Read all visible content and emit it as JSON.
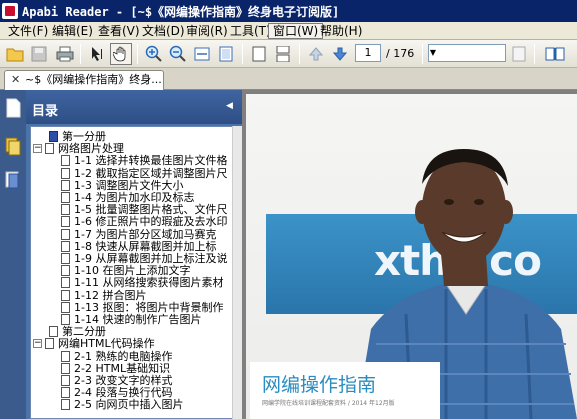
{
  "window": {
    "title": "Apabi Reader - [~$《网编操作指南》终身电子订阅版]"
  },
  "menu": {
    "items": [
      "文件(F)",
      "编辑(E)",
      "查看(V)",
      "文档(D)",
      "审阅(R)",
      "工具(T)",
      "窗口(W)",
      "帮助(H)"
    ],
    "active": "窗口(W)"
  },
  "toolbar": {
    "current_page": "1",
    "page_total": "/ 176",
    "icons": [
      "open-folder",
      "save",
      "print",
      "select-arrow",
      "hand",
      "zoom-in",
      "zoom-out",
      "fit-width",
      "fit-page",
      "single-page",
      "continuous",
      "previous-page",
      "next-page",
      "zoom-dropdown",
      "bookmark"
    ]
  },
  "tab": {
    "label": "~$《网编操作指南》终身..."
  },
  "panel": {
    "title": "目录"
  },
  "outline": [
    {
      "label": "第一分册",
      "level": 0,
      "kind": "book"
    },
    {
      "label": "网络图片处理",
      "level": 0,
      "kind": "folder",
      "expanded": true
    },
    {
      "label": "1-1 选择并转换最佳图片文件格",
      "level": 1,
      "kind": "doc"
    },
    {
      "label": "1-2 截取指定区域并调整图片尺",
      "level": 1,
      "kind": "doc"
    },
    {
      "label": "1-3 调整图片文件大小",
      "level": 1,
      "kind": "doc"
    },
    {
      "label": "1-4 为图片加水印及标志",
      "level": 1,
      "kind": "doc"
    },
    {
      "label": "1-5 批量调整图片格式、文件尺",
      "level": 1,
      "kind": "doc"
    },
    {
      "label": "1-6 修正照片中的瑕疵及去水印",
      "level": 1,
      "kind": "doc"
    },
    {
      "label": "1-7 为图片部分区域加马赛克",
      "level": 1,
      "kind": "doc"
    },
    {
      "label": "1-8 快速从屏幕截图并加上标",
      "level": 1,
      "kind": "doc"
    },
    {
      "label": "1-9 从屏幕截图并加上标注及说",
      "level": 1,
      "kind": "doc"
    },
    {
      "label": "1-10 在图片上添加文字",
      "level": 1,
      "kind": "doc"
    },
    {
      "label": "1-11 从网络搜索获得图片素材",
      "level": 1,
      "kind": "doc"
    },
    {
      "label": "1-12 拼合图片",
      "level": 1,
      "kind": "doc"
    },
    {
      "label": "1-13 抠图：将图片中背景制作",
      "level": 1,
      "kind": "doc"
    },
    {
      "label": "1-14 快速的制作广告图片",
      "level": 1,
      "kind": "doc"
    },
    {
      "label": "第二分册",
      "level": 0,
      "kind": "doc"
    },
    {
      "label": "网编HTML代码操作",
      "level": 0,
      "kind": "folder",
      "expanded": true
    },
    {
      "label": "2-1 熟练的电脑操作",
      "level": 1,
      "kind": "doc"
    },
    {
      "label": "2-2 HTML基础知识",
      "level": 1,
      "kind": "doc"
    },
    {
      "label": "2-3 改变文字的样式",
      "level": 1,
      "kind": "doc"
    },
    {
      "label": "2-4 段落与换行代码",
      "level": 1,
      "kind": "doc"
    },
    {
      "label": "2-5 向网页中插入图片",
      "level": 1,
      "kind": "doc"
    }
  ],
  "document": {
    "banner_text": "xthe co",
    "book_title": "网编操作指南",
    "book_subtitle": "网编学院在线培训课程配套资料 / 2014 年12月版"
  }
}
